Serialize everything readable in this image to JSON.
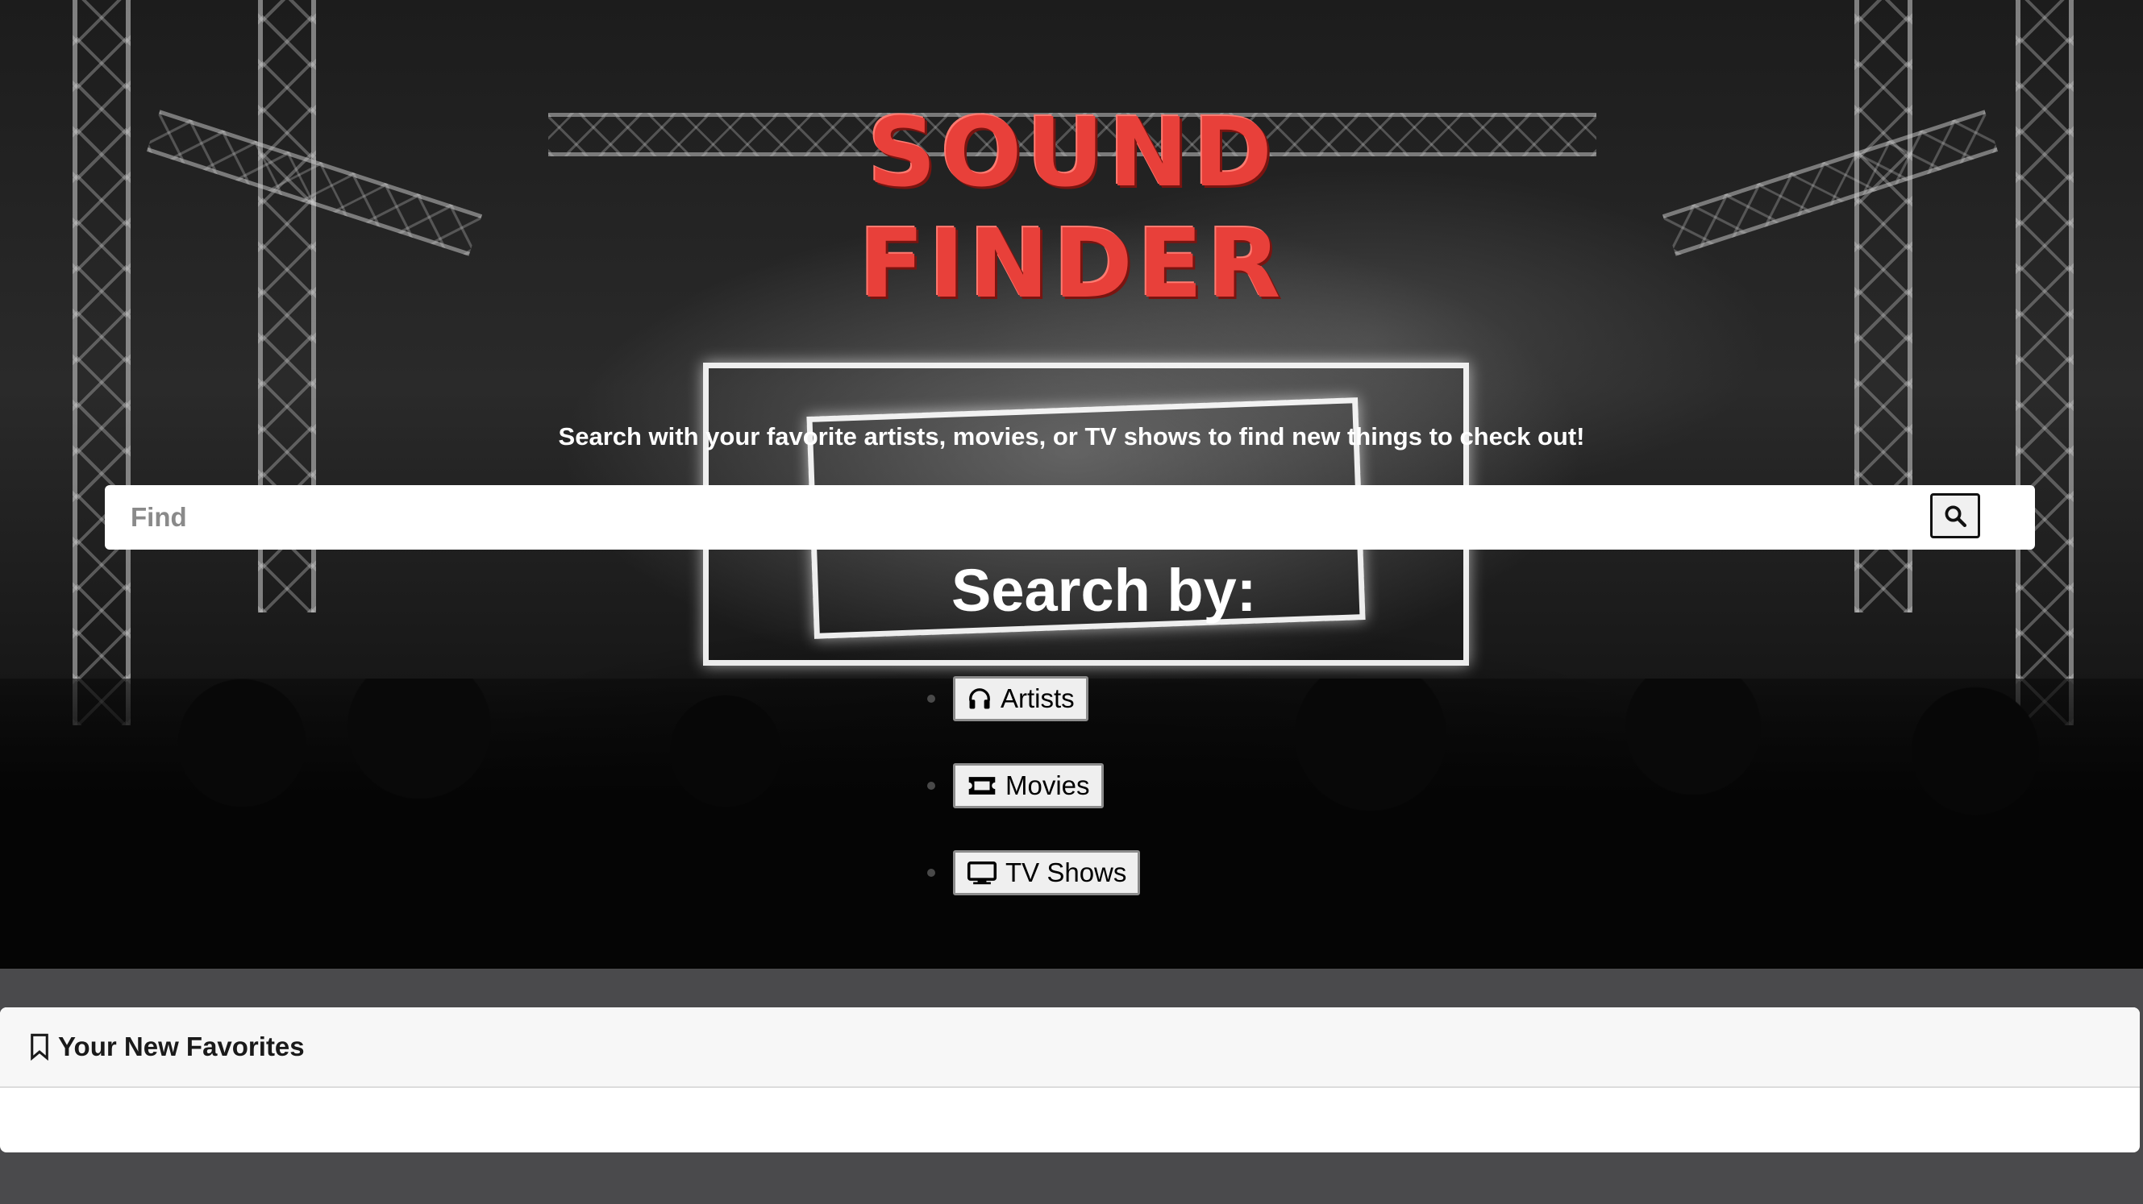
{
  "hero": {
    "logo_line1": "SOUND",
    "logo_line2": "FINDER",
    "tagline": "Search with your favorite artists, movies, or TV shows to find new things to check out!"
  },
  "search": {
    "placeholder": "Find",
    "button_icon": "search-icon"
  },
  "search_by": {
    "heading": "Search by:",
    "options": [
      {
        "label": "Artists",
        "icon": "headphones-icon"
      },
      {
        "label": "Movies",
        "icon": "ticket-icon"
      },
      {
        "label": "TV Shows",
        "icon": "tv-icon"
      }
    ]
  },
  "favorites": {
    "title": "Your New Favorites",
    "icon": "bookmark-icon"
  },
  "colors": {
    "logo": "#e8403a",
    "page_background": "#4a4a4c"
  }
}
